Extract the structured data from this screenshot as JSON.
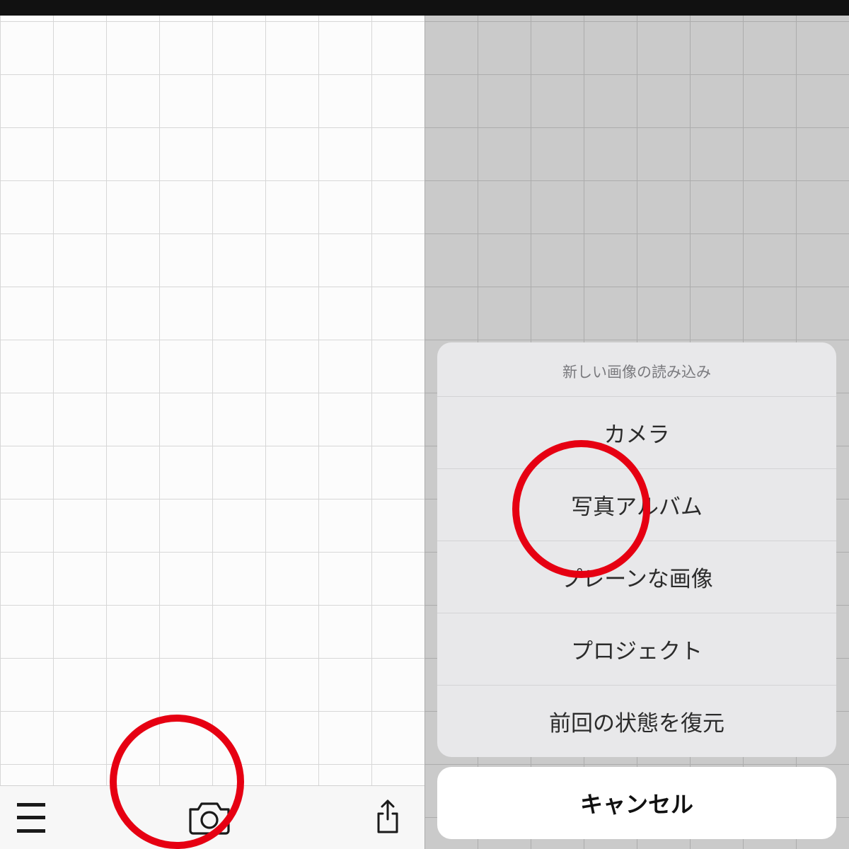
{
  "left": {
    "toolbar": {
      "menu_icon": "menu-icon",
      "camera_icon": "camera-icon",
      "share_icon": "share-icon"
    }
  },
  "right": {
    "sheet": {
      "title": "新しい画像の読み込み",
      "options": [
        "カメラ",
        "写真アルバム",
        "プレーンな画像",
        "プロジェクト",
        "前回の状態を復元"
      ],
      "cancel": "キャンセル"
    }
  },
  "annotations": {
    "left_circle_target": "camera-button",
    "right_circle_target": "photo-album-option"
  }
}
